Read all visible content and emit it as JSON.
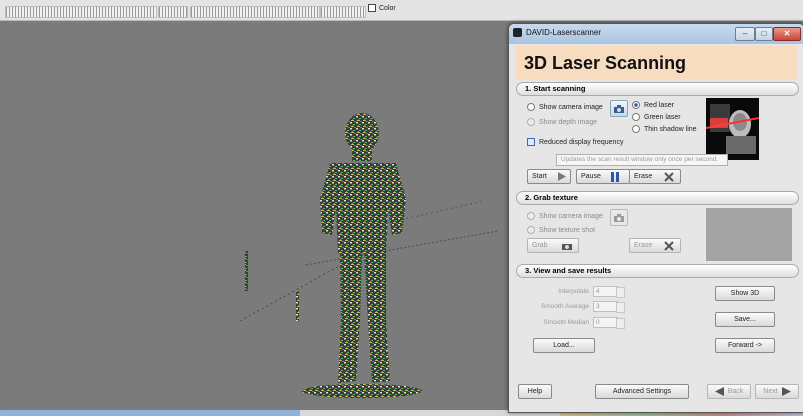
{
  "toolbar": {
    "color_label": "Color"
  },
  "dialog": {
    "title": "DAVID-Laserscanner",
    "header": "3D Laser Scanning",
    "window_buttons": {
      "minimize": "‒",
      "maximize": "□",
      "close": "✕"
    },
    "section1": {
      "title": "1. Start scanning",
      "show_camera_image": "Show camera image",
      "show_depth_image": "Show depth image",
      "red_laser": "Red laser",
      "green_laser": "Green laser",
      "thin_shadow_line": "Thin shadow line",
      "reduced_display_frequency": "Reduced display frequency",
      "tooltip": "Updates the scan result window only once per second.",
      "start": "Start",
      "pause": "Pause",
      "erase": "Erase"
    },
    "section2": {
      "title": "2. Grab texture",
      "show_camera_image": "Show camera image",
      "show_texture_shot": "Show texture shot",
      "grab": "Grab",
      "erase": "Erase"
    },
    "section3": {
      "title": "3. View and save results",
      "interpolate_label": "Interpolate",
      "interpolate_value": "4",
      "smooth_average_label": "Smooth Average",
      "smooth_average_value": "3",
      "smooth_median_label": "Smooth Median",
      "smooth_median_value": "0",
      "show3d": "Show 3D",
      "save": "Save...",
      "load": "Load...",
      "forward": "Forward ->"
    },
    "footer": {
      "help": "Help",
      "advanced_settings": "Advanced Settings",
      "back": "Back",
      "next": "Next"
    }
  }
}
